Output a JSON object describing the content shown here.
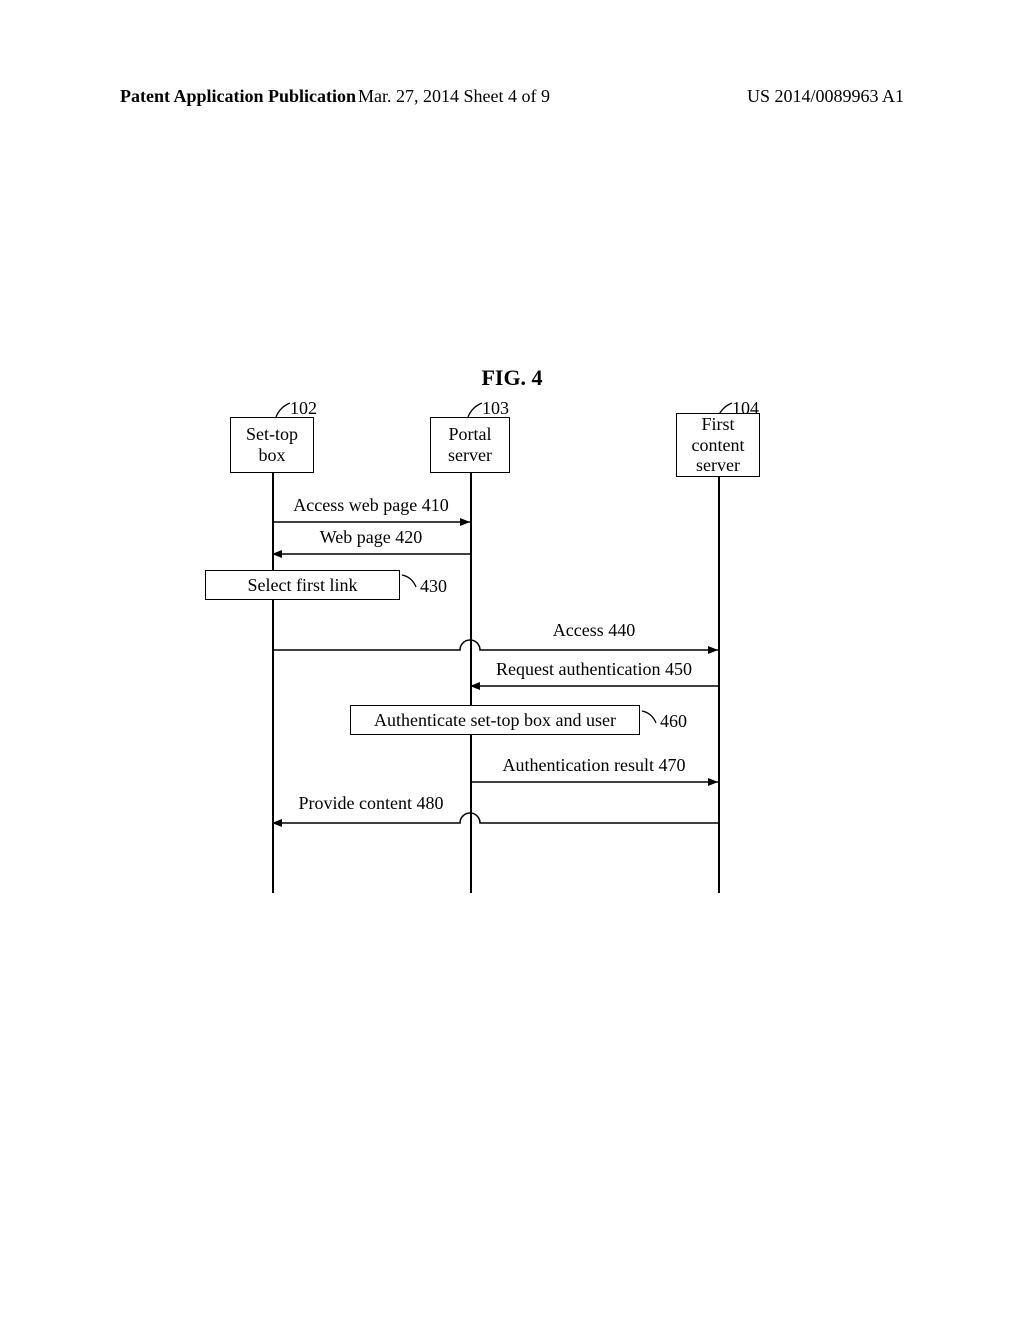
{
  "header": {
    "left": "Patent Application Publication",
    "center": "Mar. 27, 2014  Sheet 4 of 9",
    "right": "US 2014/0089963 A1"
  },
  "figure": {
    "title": "FIG. 4"
  },
  "participants": {
    "p1": {
      "label": "Set-top\nbox",
      "ref": "102"
    },
    "p2": {
      "label": "Portal\nserver",
      "ref": "103"
    },
    "p3": {
      "label": "First\ncontent\nserver",
      "ref": "104"
    }
  },
  "processes": {
    "select_link": {
      "label": "Select first link",
      "ref": "430"
    },
    "authenticate": {
      "label": "Authenticate set-top box and user",
      "ref": "460"
    }
  },
  "messages": {
    "m410": "Access web page 410",
    "m420": "Web page 420",
    "m440": "Access 440",
    "m450": "Request authentication 450",
    "m470": "Authentication result 470",
    "m480": "Provide content 480"
  }
}
